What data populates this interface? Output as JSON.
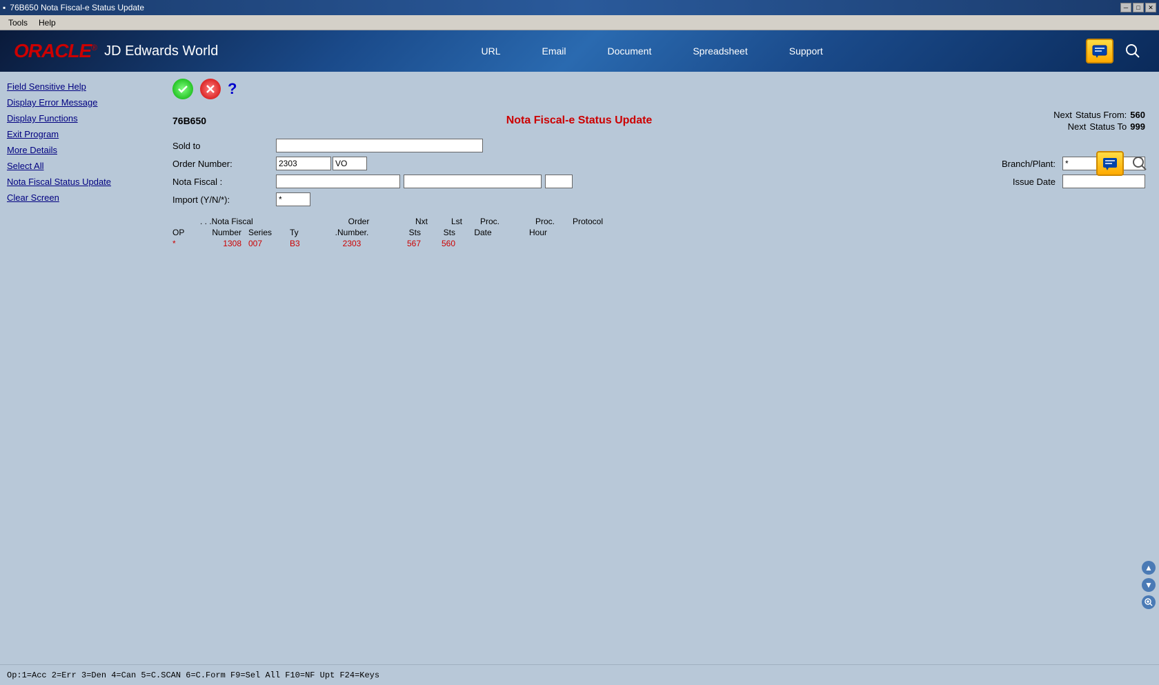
{
  "titlebar": {
    "icon": "▪",
    "title": "76B650   Nota Fiscal-e Status Update",
    "btn_min": "─",
    "btn_max": "□",
    "btn_close": "✕"
  },
  "menubar": {
    "items": [
      "Tools",
      "Help"
    ]
  },
  "oracle": {
    "logo_oracle": "ORACLE",
    "logo_registered": "®",
    "logo_jde": "JD Edwards World",
    "nav": {
      "url": "URL",
      "email": "Email",
      "document": "Document",
      "spreadsheet": "Spreadsheet",
      "support": "Support"
    }
  },
  "sidebar": {
    "items": [
      {
        "id": "field-sensitive-help",
        "label": "Field Sensitive Help",
        "clickable": true
      },
      {
        "id": "display-error-message",
        "label": "Display Error Message",
        "clickable": true
      },
      {
        "id": "display-functions",
        "label": "Display Functions",
        "clickable": true
      },
      {
        "id": "exit-program",
        "label": "Exit Program",
        "clickable": true
      },
      {
        "id": "more-details",
        "label": "More Details",
        "clickable": true
      },
      {
        "id": "select-all",
        "label": "Select All",
        "clickable": true
      },
      {
        "id": "nota-fiscal-status-update",
        "label": "Nota Fiscal Status Update",
        "clickable": true
      },
      {
        "id": "clear-screen",
        "label": "Clear Screen",
        "clickable": true
      }
    ]
  },
  "form": {
    "id": "76B650",
    "title": "Nota Fiscal-e Status Update",
    "next_status_from_label": "Next",
    "next_status_from_label2": "Status From:",
    "next_status_from_value": "560",
    "next_status_to_label": "Next",
    "next_status_to_label2": "Status To",
    "next_status_to_value": "999",
    "sold_to_label": "Sold to",
    "sold_to_value": "",
    "order_number_label": "Order Number:",
    "order_number_value": "2303",
    "order_type_value": "VO",
    "nota_fiscal_label": "Nota Fiscal :",
    "nota_fiscal_value": "",
    "nota_fiscal_extra1": "",
    "nota_fiscal_extra2": "",
    "import_label": "Import (Y/N/*):",
    "import_value": "*",
    "branch_plant_label": "Branch/Plant:",
    "branch_plant_value": "*",
    "issue_date_label": "Issue Date",
    "issue_date_value": ""
  },
  "table": {
    "headers": {
      "op": "OP",
      "nota_fiscal_number": "Number",
      "nota_fiscal_label": ". . .Nota Fiscal",
      "series": "Series",
      "ty": "Ty",
      "order_number": "Order",
      "order_sub": ".Number.",
      "nxt_sts": "Nxt",
      "nxt_sts2": "Sts",
      "lst_sts": "Lst",
      "lst_sts2": "Sts",
      "proc_date": "Proc.",
      "proc_date2": "Date",
      "proc_hour": "Proc.",
      "proc_hour2": "Hour",
      "protocol": "Protocol"
    },
    "rows": [
      {
        "op": "*",
        "number": "1308",
        "series": "007",
        "ty": "B3",
        "order_number": "2303",
        "nxt_sts": "567",
        "lst_sts": "560",
        "proc_date": "",
        "proc_hour": "",
        "protocol": ""
      }
    ]
  },
  "statusbar": {
    "text": "Op:1=Acc 2=Err 3=Den 4=Can 5=C.SCAN 6=C.Form F9=Sel All F10=NF Upt F24=Keys"
  }
}
